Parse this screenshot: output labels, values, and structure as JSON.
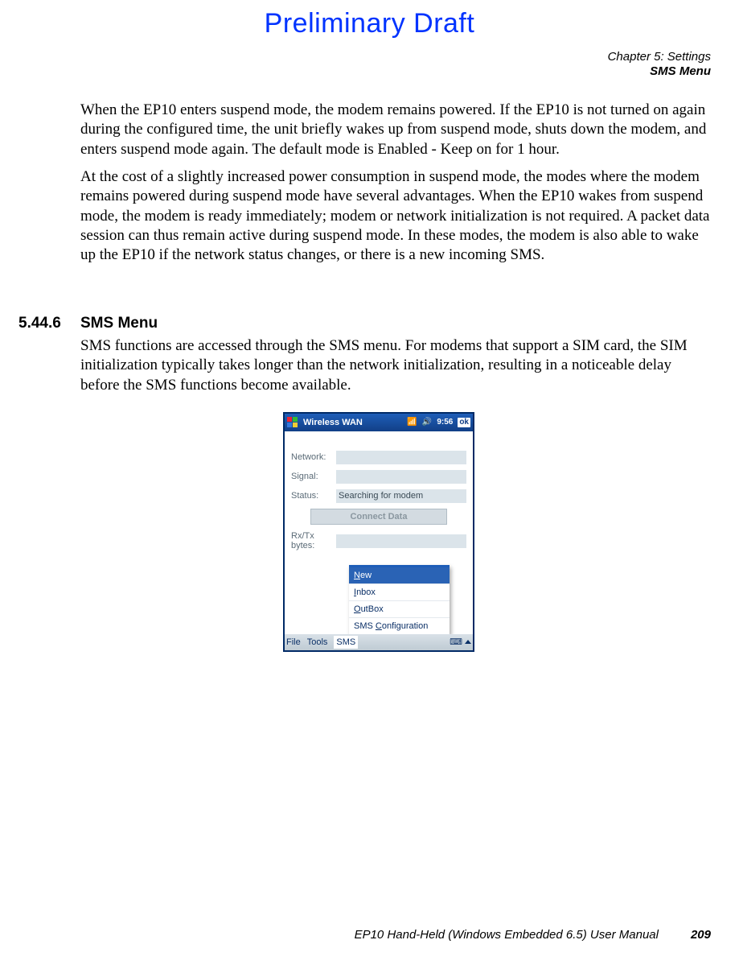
{
  "watermark": "Preliminary Draft",
  "header": {
    "chapter": "Chapter 5:  Settings",
    "section": "SMS Menu"
  },
  "body": {
    "p1": "When the EP10 enters suspend mode, the modem remains powered. If the EP10 is not turned on again during the configured time, the unit briefly wakes up from suspend mode, shuts down the modem, and enters suspend mode again. The default mode is Enabled - Keep on for 1 hour.",
    "p2": "At the cost of a slightly increased power consumption in suspend mode, the modes where the modem remains powered during suspend mode have several advantages. When the EP10 wakes from suspend mode, the modem is ready immediately; modem or network initialization is not required. A packet data session can thus remain active during suspend mode. In these modes, the modem is also able to wake up the EP10 if the network status changes, or there is a new incoming SMS."
  },
  "section": {
    "number": "5.44.6",
    "title": "SMS Menu",
    "p1": "SMS functions are accessed through the SMS menu. For modems that support a SIM card, the SIM initialization typically takes longer than the network initialization, resulting in a noticeable delay before the SMS functions become available."
  },
  "device": {
    "titlebar": {
      "title": "Wireless WAN",
      "time": "9:56",
      "ok": "ok"
    },
    "labels": {
      "network": "Network:",
      "signal": "Signal:",
      "status": "Status:",
      "rxtx": "Rx/Tx\nbytes:"
    },
    "values": {
      "network": "",
      "signal": "",
      "status": "Searching for modem",
      "rxtx": ""
    },
    "connect_btn": "Connect Data",
    "menu": {
      "items": [
        {
          "u": "N",
          "rest": "ew"
        },
        {
          "u": "I",
          "rest": "nbox"
        },
        {
          "u": "O",
          "rest": "utBox"
        },
        {
          "u": "C",
          "rest": "onfiguration",
          "prefix": "SMS "
        }
      ]
    },
    "bottombar": {
      "file": "File",
      "tools": "Tools",
      "sms": "SMS"
    }
  },
  "footer": {
    "manual": "EP10 Hand-Held (Windows Embedded 6.5) User Manual",
    "page": "209"
  }
}
